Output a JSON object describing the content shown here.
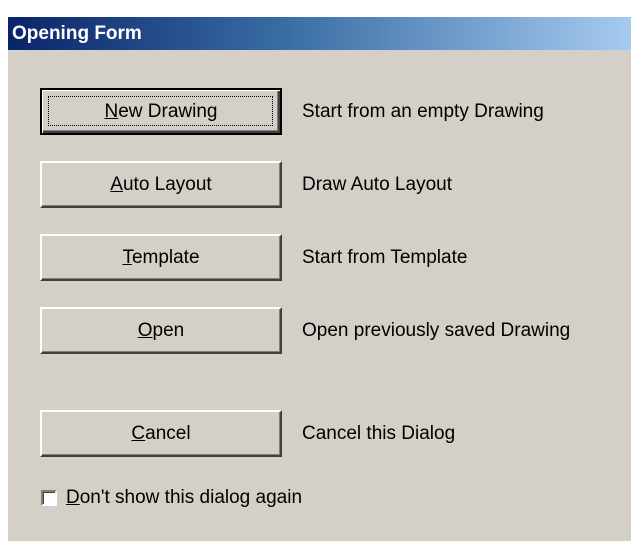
{
  "window": {
    "title": "Opening Form"
  },
  "buttons": [
    {
      "id": "new-drawing",
      "mnemonic": "N",
      "rest": "ew Drawing",
      "description": "Start from an empty  Drawing",
      "default": true
    },
    {
      "id": "auto-layout",
      "mnemonic": "A",
      "rest": "uto Layout",
      "description": "Draw Auto Layout",
      "default": false
    },
    {
      "id": "template",
      "mnemonic": "T",
      "rest": "emplate",
      "description": "Start from Template",
      "default": false
    },
    {
      "id": "open",
      "mnemonic": "O",
      "rest": "pen",
      "description": "Open previously saved Drawing",
      "default": false
    },
    {
      "id": "cancel",
      "mnemonic": "C",
      "rest": "ancel",
      "description": "Cancel this Dialog",
      "default": false
    }
  ],
  "checkbox": {
    "mnemonic": "D",
    "rest": "on't show this dialog again",
    "checked": false
  },
  "colors": {
    "dialog_bg": "#d4d0c8",
    "title_gradient_start": "#0a246a",
    "title_gradient_end": "#a6caf0",
    "title_text": "#ffffff"
  }
}
